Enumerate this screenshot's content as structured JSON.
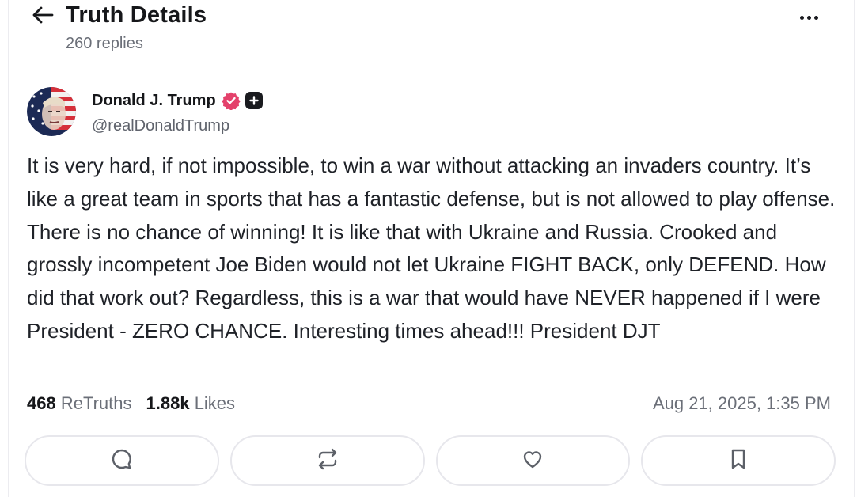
{
  "header": {
    "title": "Truth Details",
    "subtitle": "260 replies",
    "back_icon": "arrow-left-icon",
    "more_icon": "more-horizontal-icon"
  },
  "post": {
    "author": {
      "name": "Donald J. Trump",
      "handle": "@realDonaldTrump",
      "verified_icon": "verified-badge-icon",
      "verified_color": "#e4416b",
      "plus_icon": "plus-badge-icon"
    },
    "text": "It is very hard, if not impossible, to win a war without attacking an invaders country. It’s like a great team in sports that has a fantastic defense, but is not allowed to play offense. There is no chance of winning! It is like that with Ukraine and Russia. Crooked and grossly incompetent Joe Biden would not let Ukraine FIGHT BACK, only DEFEND. How did that work out? Regardless, this is a war that would have NEVER happened if I were President - ZERO CHANCE. Interesting times ahead!!! President DJT",
    "stats": {
      "retruths_count": "468",
      "retruths_label": "ReTruths",
      "likes_count": "1.88k",
      "likes_label": "Likes"
    },
    "timestamp": "Aug 21, 2025, 1:35 PM"
  },
  "actions": [
    {
      "name": "reply",
      "icon": "comment-icon"
    },
    {
      "name": "retruth",
      "icon": "repost-icon"
    },
    {
      "name": "like",
      "icon": "heart-icon"
    },
    {
      "name": "bookmark",
      "icon": "bookmark-icon"
    }
  ]
}
